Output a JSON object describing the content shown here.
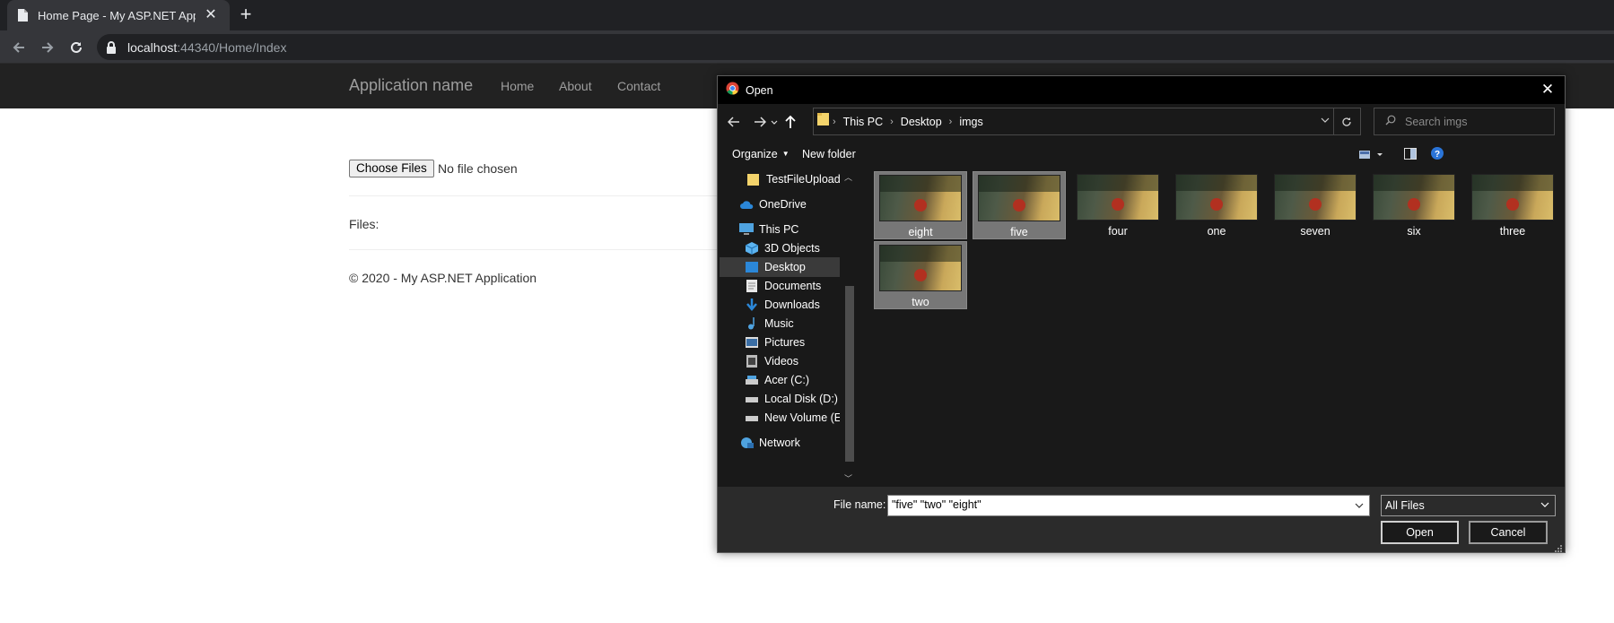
{
  "browser": {
    "tab_title": "Home Page - My ASP.NET Applic",
    "url_host": "localhost",
    "url_rest": ":44340/Home/Index"
  },
  "site": {
    "brand": "Application name",
    "nav": [
      "Home",
      "About",
      "Contact"
    ],
    "choose_files_label": "Choose Files",
    "file_status": "No file chosen",
    "files_label": "Files:",
    "footer": "© 2020 - My ASP.NET Application"
  },
  "dialog": {
    "title": "Open",
    "breadcrumb": [
      "This PC",
      "Desktop",
      "imgs"
    ],
    "search_placeholder": "Search imgs",
    "organize_label": "Organize",
    "new_folder_label": "New folder",
    "sidebar": [
      "TestFileUpload",
      "OneDrive",
      "This PC",
      "3D Objects",
      "Desktop",
      "Documents",
      "Downloads",
      "Music",
      "Pictures",
      "Videos",
      "Acer (C:)",
      "Local Disk (D:)",
      "New Volume (E:)",
      "Network"
    ],
    "selected_sidebar": "Desktop",
    "files": [
      {
        "name": "eight",
        "selected": true
      },
      {
        "name": "five",
        "selected": true
      },
      {
        "name": "four",
        "selected": false
      },
      {
        "name": "one",
        "selected": false
      },
      {
        "name": "seven",
        "selected": false
      },
      {
        "name": "six",
        "selected": false
      },
      {
        "name": "three",
        "selected": false
      },
      {
        "name": "two",
        "selected": true
      }
    ],
    "file_name_label": "File name:",
    "file_name_value": "\"five\" \"two\" \"eight\"",
    "file_type": "All Files",
    "open_label": "Open",
    "cancel_label": "Cancel"
  }
}
